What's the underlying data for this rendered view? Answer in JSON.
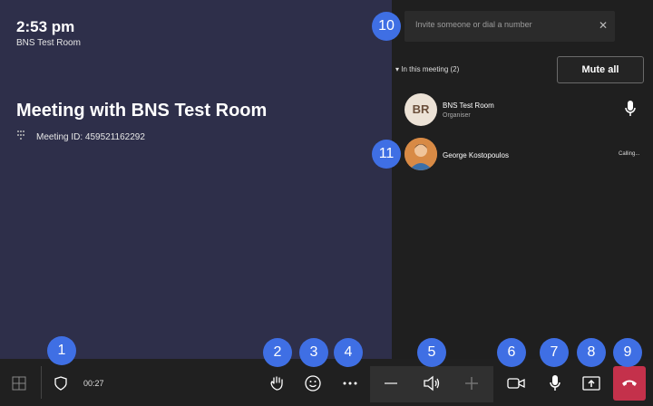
{
  "meeting": {
    "time": "2:53 pm",
    "room_name": "BNS Test Room",
    "title": "Meeting with BNS Test Room",
    "meeting_id_label": "Meeting ID: 459521162292"
  },
  "panel": {
    "invite_placeholder": "Invite someone or dial a number",
    "in_meeting_label": "In this meeting (2)",
    "mute_all_label": "Mute all",
    "participants": [
      {
        "initials": "BR",
        "name": "BNS Test Room",
        "role": "Organiser",
        "icon": "mic-icon"
      },
      {
        "name": "George Kostopoulos",
        "status": "Calling..."
      }
    ]
  },
  "toolbar": {
    "timer": "00:27"
  },
  "badges": [
    "1",
    "2",
    "3",
    "4",
    "5",
    "6",
    "7",
    "8",
    "9",
    "10",
    "11"
  ],
  "colors": {
    "left_bg": "#2e2f4a",
    "panel_bg": "#1f1f1f",
    "badge": "#3f6fe4",
    "hangup": "#c4314b"
  }
}
